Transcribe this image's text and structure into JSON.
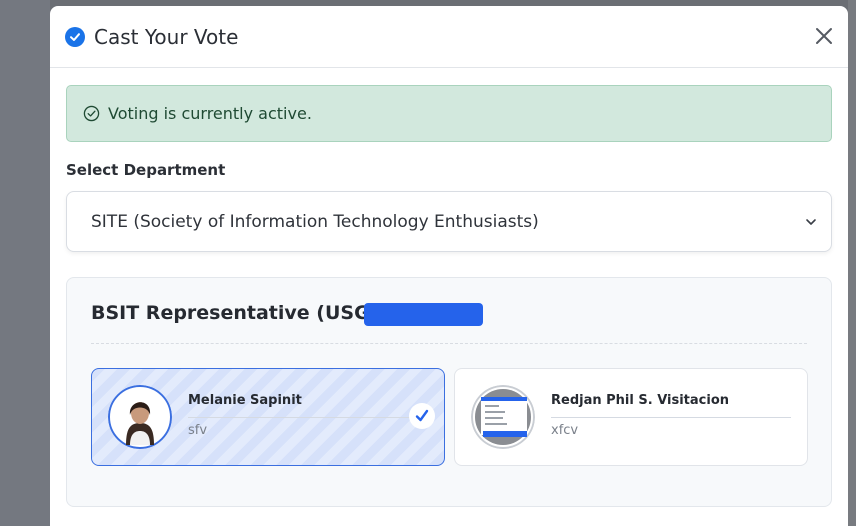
{
  "modal": {
    "title": "Cast Your Vote",
    "close_icon": "close-icon"
  },
  "alert": {
    "text": "Voting is currently active.",
    "icon": "check-circle-icon"
  },
  "department": {
    "label": "Select Department",
    "selected": "SITE (Society of Information Technology Enthusiasts)"
  },
  "position": {
    "title": "BSIT Representative (USG)",
    "candidates": [
      {
        "name": "Melanie Sapinit",
        "subtitle": "sfv",
        "selected": true
      },
      {
        "name": "Redjan Phil S. Visitacion",
        "subtitle": "xfcv",
        "selected": false
      }
    ]
  },
  "colors": {
    "accent": "#2563eb",
    "alert_bg": "#d2e8dd",
    "selected_border": "#3b6fe0"
  }
}
